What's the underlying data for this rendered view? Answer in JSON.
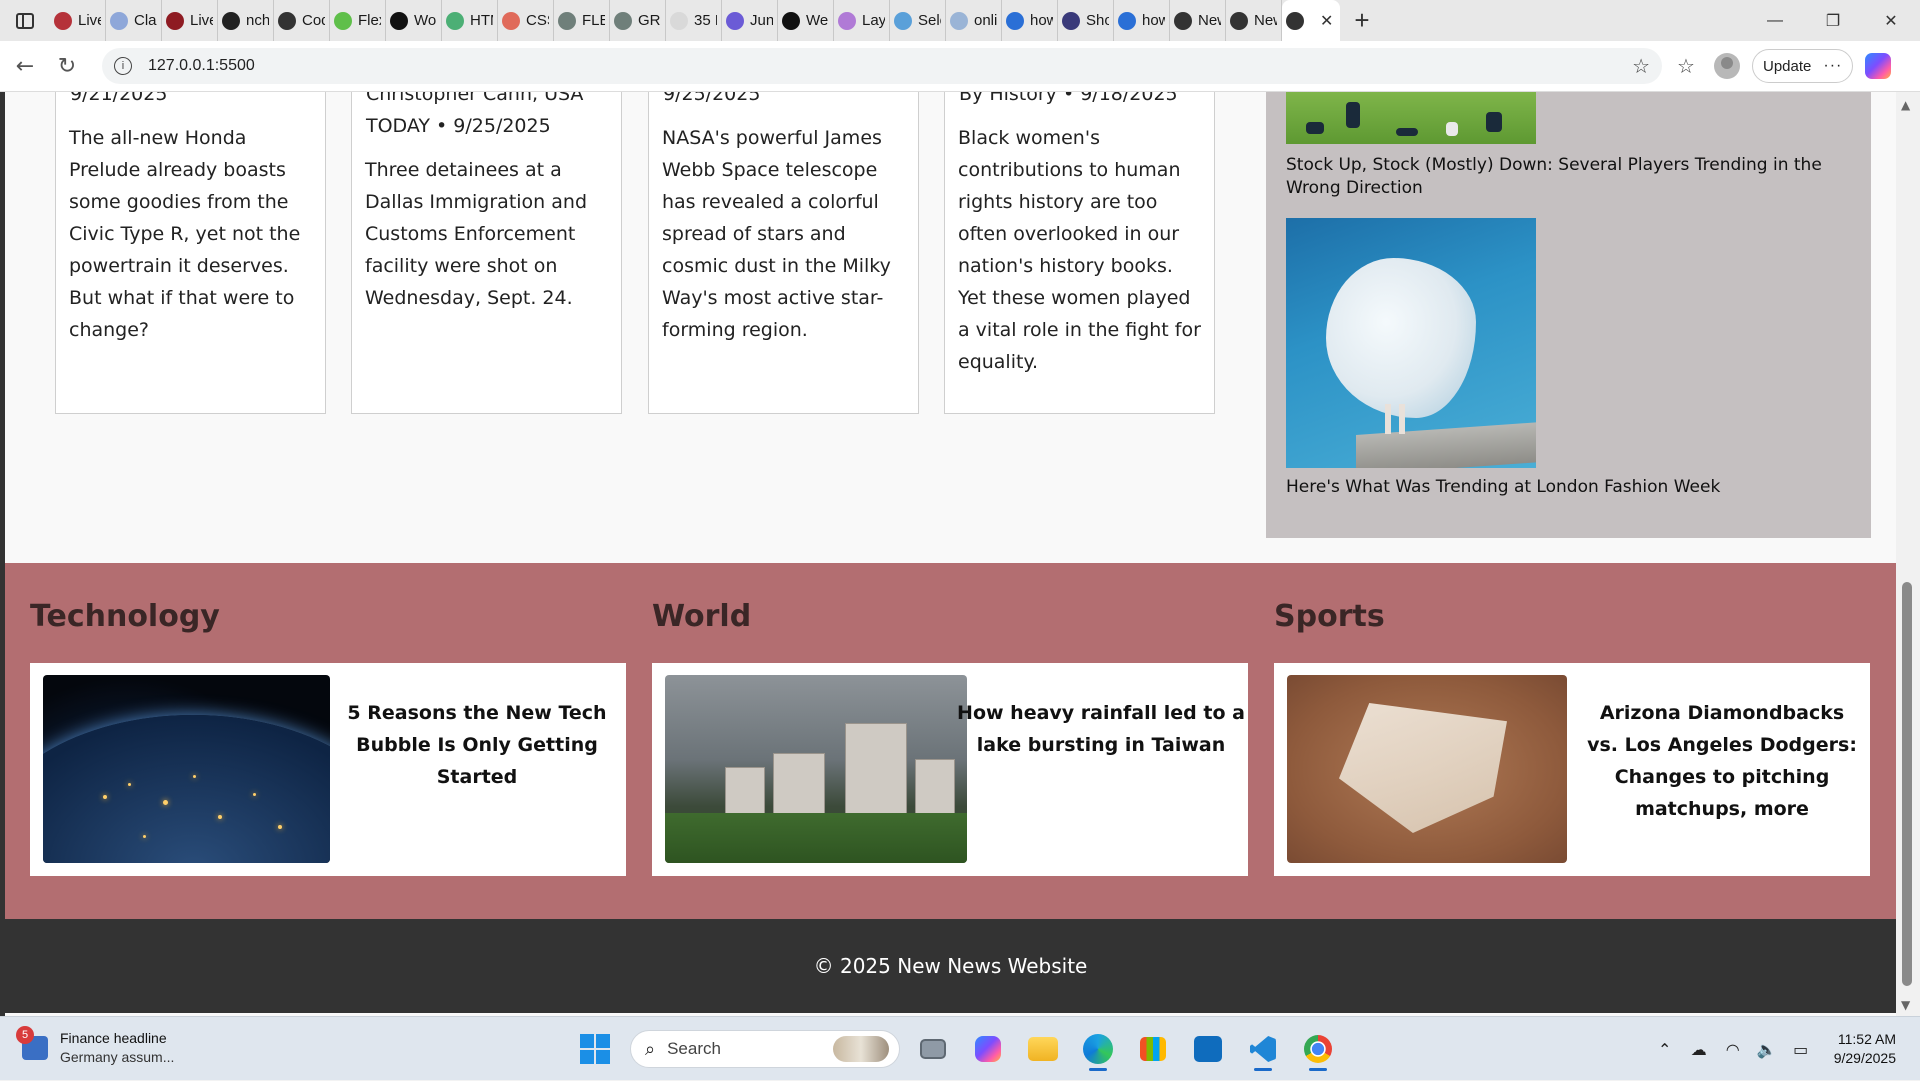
{
  "browser": {
    "tabs": [
      {
        "label": "Live",
        "icon": "ct-icon",
        "color": "#b5323a"
      },
      {
        "label": "Clas",
        "icon": "classroom-icon",
        "color": "#8ea7d9"
      },
      {
        "label": "Live",
        "icon": "ct-icon",
        "color": "#8e1b22"
      },
      {
        "label": "nch",
        "icon": "github-icon",
        "color": "#222222"
      },
      {
        "label": "Cod",
        "icon": "openai-icon",
        "color": "#333333"
      },
      {
        "label": "Flex",
        "icon": "frog-icon",
        "color": "#5fbf4a"
      },
      {
        "label": "Wor",
        "icon": "wordpress-icon",
        "color": "#111111"
      },
      {
        "label": "HTM",
        "icon": "w3schools-icon",
        "color": "#4caf75"
      },
      {
        "label": "CSS",
        "icon": "asterisk-icon",
        "color": "#e06a5a"
      },
      {
        "label": "FLE",
        "icon": "grid-icon",
        "color": "#6f7f7a"
      },
      {
        "label": "GRI",
        "icon": "grid-icon",
        "color": "#6f7f7a"
      },
      {
        "label": "35 L",
        "icon": "page-icon",
        "color": "#d9d9d9"
      },
      {
        "label": "Junc",
        "icon": "target-icon",
        "color": "#6b5bd6"
      },
      {
        "label": "Wel",
        "icon": "b-icon",
        "color": "#111111"
      },
      {
        "label": "Lay",
        "icon": "b-icon",
        "color": "#b07ad6"
      },
      {
        "label": "Sele",
        "icon": "puzzle-icon",
        "color": "#5aa0d9"
      },
      {
        "label": "onli",
        "icon": "search-icon",
        "color": "#9ab4d6"
      },
      {
        "label": "how",
        "icon": "search-icon",
        "color": "#2a6fd6"
      },
      {
        "label": "Sho",
        "icon": "shop-icon",
        "color": "#3a3a7a"
      },
      {
        "label": "how",
        "icon": "search-icon",
        "color": "#2a6fd6"
      },
      {
        "label": "New",
        "icon": "globe-icon",
        "color": "#333333"
      },
      {
        "label": "New",
        "icon": "globe-icon",
        "color": "#333333"
      },
      {
        "label": "",
        "icon": "globe-icon",
        "color": "#333333"
      }
    ],
    "url": "127.0.0.1:5500",
    "update_label": "Update"
  },
  "page": {
    "cards": [
      {
        "meta": "9/21/2025",
        "desc": "The all-new Honda Prelude already boasts some goodies from the Civic Type R, yet not the powertrain it deserves. But what if that were to change?"
      },
      {
        "meta": "Christopher Cann, USA TODAY • 9/25/2025",
        "desc": "Three detainees at a Dallas Immigration and Customs Enforcement facility were shot on Wednesday, Sept. 24."
      },
      {
        "meta": "9/25/2025",
        "desc": "NASA's powerful James Webb Space telescope has revealed a colorful spread of stars and cosmic dust in the Milky Way's most active star-forming region."
      },
      {
        "meta": "By History • 9/18/2025",
        "desc": "Black women's contributions to human rights history are too often overlooked in our nation's history books. Yet these women played a vital role in the fight for equality."
      }
    ],
    "trending": [
      {
        "caption": "Stock Up, Stock (Mostly) Down: Several Players Trending in the Wrong Direction"
      },
      {
        "caption": "Here's What Was Trending at London Fashion Week"
      }
    ],
    "sections": [
      {
        "title": "Technology",
        "headline": "5 Reasons the New Tech Bubble Is Only Getting Started"
      },
      {
        "title": "World",
        "headline": "How heavy rainfall led to a lake bursting in Taiwan"
      },
      {
        "title": "Sports",
        "headline": "Arizona Diamondbacks vs. Los Angeles Dodgers: Changes to pitching matchups, more"
      }
    ],
    "footer": "© 2025 New News Website"
  },
  "taskbar": {
    "news_badge": "5",
    "news_title": "Finance headline",
    "news_sub": "Germany assum...",
    "search_placeholder": "Search",
    "time": "11:52 AM",
    "date": "9/29/2025"
  }
}
